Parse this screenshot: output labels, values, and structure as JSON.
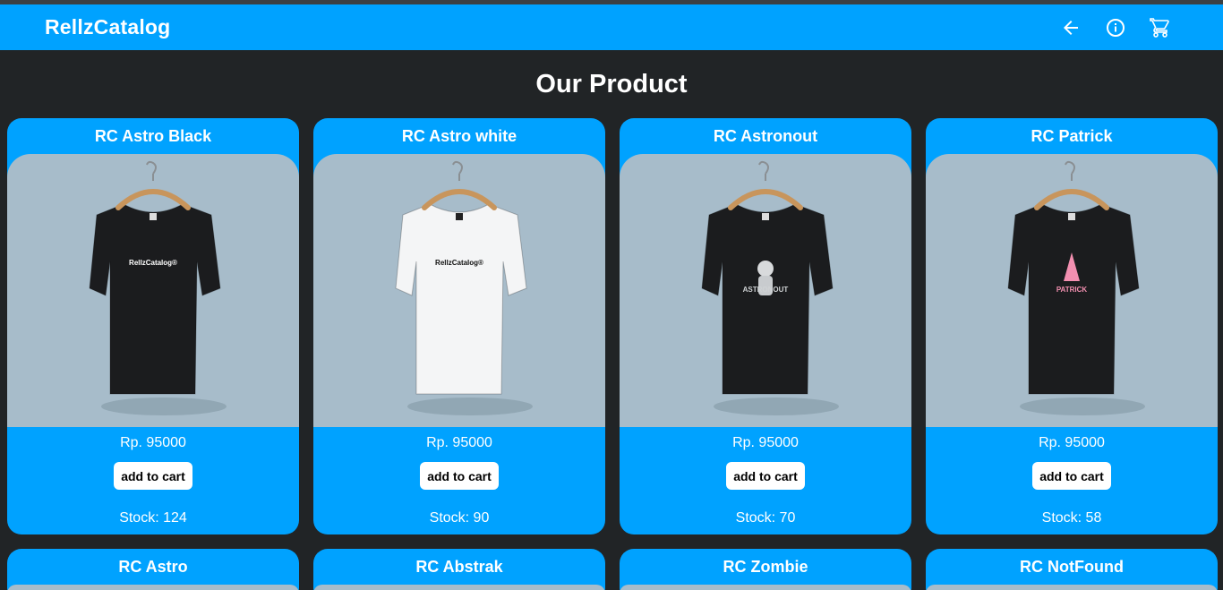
{
  "navbar": {
    "brand": "RellzCatalog",
    "icons": [
      "arrow-back-icon",
      "info-icon",
      "cart-icon"
    ]
  },
  "page": {
    "title": "Our Product"
  },
  "products": [
    {
      "name": "RC Astro Black",
      "price": "Rp. 95000",
      "button": "add to cart",
      "stock": "Stock: 124",
      "shirt_color": "#1b1c1e",
      "print": "RellzCatalog®",
      "print_color": "#ffffff"
    },
    {
      "name": "RC Astro white",
      "price": "Rp. 95000",
      "button": "add to cart",
      "stock": "Stock: 90",
      "shirt_color": "#f4f5f6",
      "print": "RellzCatalog®",
      "print_color": "#111111"
    },
    {
      "name": "RC Astronout",
      "price": "Rp. 95000",
      "button": "add to cart",
      "stock": "Stock: 70",
      "shirt_color": "#1b1c1e",
      "print": "ASTRONOUT",
      "print_color": "#cfd2d4"
    },
    {
      "name": "RC Patrick",
      "price": "Rp. 95000",
      "button": "add to cart",
      "stock": "Stock: 58",
      "shirt_color": "#1b1c1e",
      "print": "PATRICK",
      "print_color": "#f28fb0"
    }
  ],
  "products_next_row": [
    {
      "name": "RC Astro"
    },
    {
      "name": "RC Abstrak"
    },
    {
      "name": "RC Zombie"
    },
    {
      "name": "RC NotFound"
    }
  ],
  "colors": {
    "accent": "#00a2ff",
    "background": "#212426",
    "image_bg": "#a7bcca"
  }
}
